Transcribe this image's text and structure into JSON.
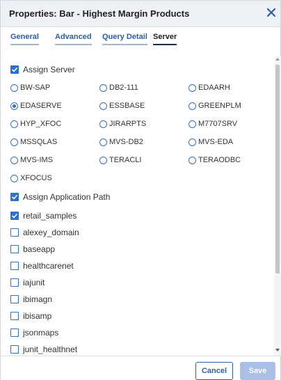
{
  "dialog": {
    "title": "Properties: Bar - Highest Margin Products"
  },
  "icons": {
    "close": "close-icon",
    "check": "check-icon"
  },
  "colors": {
    "accent": "#2d6fd0",
    "link": "#2d5ea8",
    "save_disabled": "#a9bfe6"
  },
  "tabs": [
    {
      "label": "General",
      "active": false
    },
    {
      "label": "Advanced",
      "active": false
    },
    {
      "label": "Query Detail",
      "active": false
    },
    {
      "label": "Server",
      "active": true
    }
  ],
  "server": {
    "assign_server_label": "Assign Server",
    "assign_server_checked": true,
    "selected": "EDASERVE",
    "radios": [
      "BW-SAP",
      "DB2-111",
      "EDAARH",
      "EDASERVE",
      "ESSBASE",
      "GREENPLM",
      "HYP_XFOC",
      "JIRARPTS",
      "M7707SRV",
      "MSSQLAS",
      "MVS-DB2",
      "MVS-EDA",
      "MVS-IMS",
      "TERACLI",
      "TERAODBC",
      "XFOCUS"
    ]
  },
  "app_path": {
    "assign_label": "Assign Application Path",
    "assign_checked": true,
    "items": [
      {
        "label": "retail_samples",
        "checked": true
      },
      {
        "label": "alexey_domain",
        "checked": false
      },
      {
        "label": "baseapp",
        "checked": false
      },
      {
        "label": "healthcarenet",
        "checked": false
      },
      {
        "label": "iajunit",
        "checked": false
      },
      {
        "label": "ibimagn",
        "checked": false
      },
      {
        "label": "ibisamp",
        "checked": false
      },
      {
        "label": "jsonmaps",
        "checked": false
      },
      {
        "label": "junit_healthnet",
        "checked": false
      }
    ]
  },
  "footer": {
    "cancel_label": "Cancel",
    "save_label": "Save"
  }
}
